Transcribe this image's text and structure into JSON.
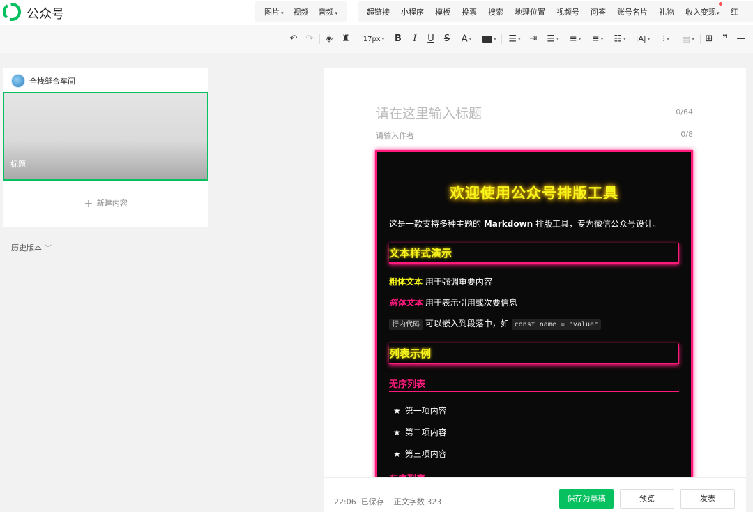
{
  "app": {
    "title": "公众号"
  },
  "media_menu": [
    {
      "label": "图片",
      "caret": "▾"
    },
    {
      "label": "视频"
    },
    {
      "label": "音频",
      "caret": "▾"
    }
  ],
  "insert_menu": [
    "超链接",
    "小程序",
    "模板",
    "投票",
    "搜索",
    "地理位置",
    "视频号",
    "问答",
    "账号名片",
    "礼物",
    "收入变现",
    "红"
  ],
  "toolbar": {
    "font_size": "17px"
  },
  "sidebar": {
    "account_name": "全栈缝合车间",
    "article_title": "标题",
    "new_content_label": "新建内容",
    "history_label": "历史版本"
  },
  "editor": {
    "title_placeholder": "请在这里输入标题",
    "title_count": "0/64",
    "author_placeholder": "请输入作者",
    "author_count": "0/8",
    "content": {
      "h1": "欢迎使用公众号排版工具",
      "intro_prefix": "这是一款支持多种主题的 ",
      "intro_bold": "Markdown",
      "intro_suffix": " 排版工具，专为微信公众号设计。",
      "section1_title": "文本样式演示",
      "bold_sample": "粗体文本",
      "bold_desc": " 用于强调重要内容",
      "italic_sample": "斜体文本",
      "italic_desc": " 用于表示引用或次要信息",
      "code_sample": "行内代码",
      "code_desc": " 可以嵌入到段落中，如 ",
      "code_example": "const name = \"value\"",
      "section2_title": "列表示例",
      "unordered_title": "无序列表",
      "list_items": [
        "第一项内容",
        "第二项内容",
        "第三项内容"
      ],
      "list_bullet": "★",
      "ordered_title": "有序列表"
    }
  },
  "footer": {
    "time": "22:06",
    "saved": "已保存",
    "word_count_label": "正文字数",
    "word_count": "323",
    "save_draft": "保存为草稿",
    "preview": "预览",
    "publish": "发表"
  },
  "colors": {
    "accent_green": "#07c160",
    "neon_pink": "#ff1a7c",
    "neon_yellow": "#f5f51d",
    "content_bg": "#0a0a0a"
  }
}
